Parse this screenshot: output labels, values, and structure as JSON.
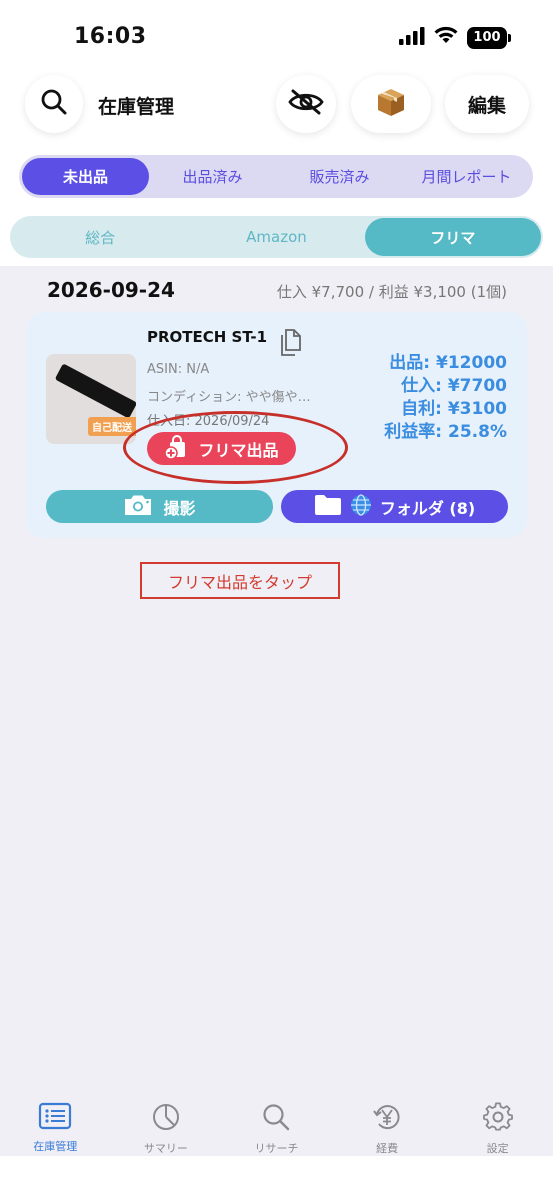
{
  "status_bar": {
    "time": "16:03",
    "battery": "100"
  },
  "header": {
    "title": "在庫管理",
    "edit_label": "編集",
    "icons": [
      "search-icon",
      "eye-slash-icon",
      "box-icon"
    ]
  },
  "main_tabs": [
    {
      "label": "未出品",
      "active": true
    },
    {
      "label": "出品済み",
      "active": false
    },
    {
      "label": "販売済み",
      "active": false
    },
    {
      "label": "月間レポート",
      "active": false
    }
  ],
  "sub_tabs": [
    {
      "label": "総合",
      "active": false
    },
    {
      "label": "Amazon",
      "active": false
    },
    {
      "label": "フリマ",
      "active": true
    }
  ],
  "group": {
    "date": "2026-09-24",
    "summary": "仕入 ¥7,700 / 利益 ¥3,100 (1個)"
  },
  "item": {
    "name": "PROTECH ST-1",
    "asin": "ASIN: N/A",
    "condition": "コンディション: やや傷や…",
    "purchase_date": "仕入日: 2026/09/24",
    "thumb_tag": "自己配送",
    "frima_button": "フリマ出品",
    "prices": {
      "listing": "出品: ¥12000",
      "purchase": "仕入: ¥7700",
      "profit": "自利: ¥3100",
      "margin": "利益率: 25.8%"
    },
    "photo_button": "撮影",
    "folder_button": "フォルダ (8)"
  },
  "hint": "フリマ出品をタップ",
  "tabbar": [
    {
      "label": "在庫管理",
      "icon": "inventory-list-icon",
      "active": true
    },
    {
      "label": "サマリー",
      "icon": "summary-chart-icon",
      "active": false
    },
    {
      "label": "リサーチ",
      "icon": "search-icon",
      "active": false
    },
    {
      "label": "経費",
      "icon": "yen-icon",
      "active": false
    },
    {
      "label": "設定",
      "icon": "gear-icon",
      "active": false
    }
  ],
  "colors": {
    "primary": "#5b4fe6",
    "teal": "#55b9c6",
    "accent_red": "#e9445a",
    "price_blue": "#3b8de0",
    "annotation_red": "#c7302a"
  }
}
